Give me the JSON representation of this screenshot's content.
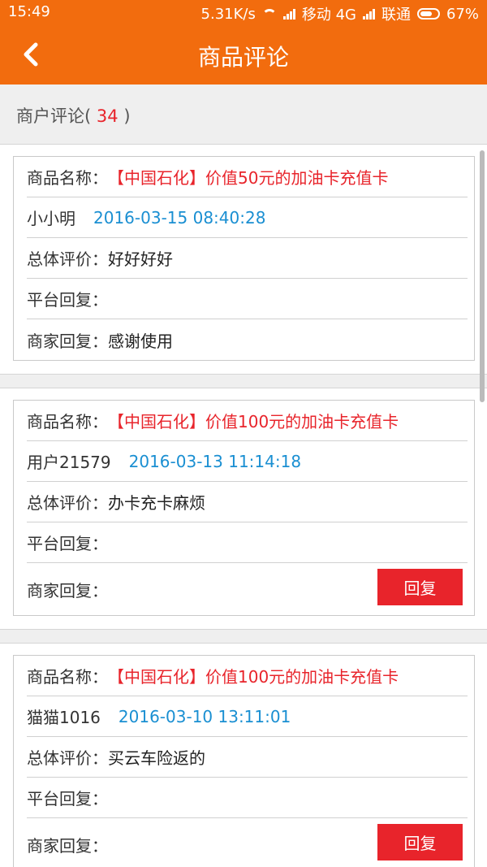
{
  "status_bar": {
    "time": "15:49",
    "speed": "5.31K/s",
    "carrier1": "移动 4G",
    "carrier2": "联通",
    "battery": "67%"
  },
  "header": {
    "title": "商品评论"
  },
  "summary": {
    "label_prefix": "商户评论(",
    "count": "34",
    "label_suffix": ")"
  },
  "labels": {
    "product_name": "商品名称：",
    "overall": "总体评价：",
    "platform_reply": "平台回复：",
    "merchant_reply": "商家回复：",
    "reply_button": "回复"
  },
  "reviews": [
    {
      "product": "【中国石化】价值50元的加油卡充值卡",
      "user": "小小明",
      "date": "2016-03-15 08:40:28",
      "overall": "好好好好",
      "platform_reply": "",
      "merchant_reply": "感谢使用"
    },
    {
      "product": "【中国石化】价值100元的加油卡充值卡",
      "user": "用户21579",
      "date": "2016-03-13 11:14:18",
      "overall": "办卡充卡麻烦",
      "platform_reply": "",
      "merchant_reply": ""
    },
    {
      "product": "【中国石化】价值100元的加油卡充值卡",
      "user": "猫猫1016",
      "date": "2016-03-10 13:11:01",
      "overall": "买云车险返的",
      "platform_reply": "",
      "merchant_reply": ""
    }
  ],
  "colors": {
    "brand": "#f26c0e",
    "accent_red": "#e8242b",
    "date_blue": "#1a8fd2"
  }
}
